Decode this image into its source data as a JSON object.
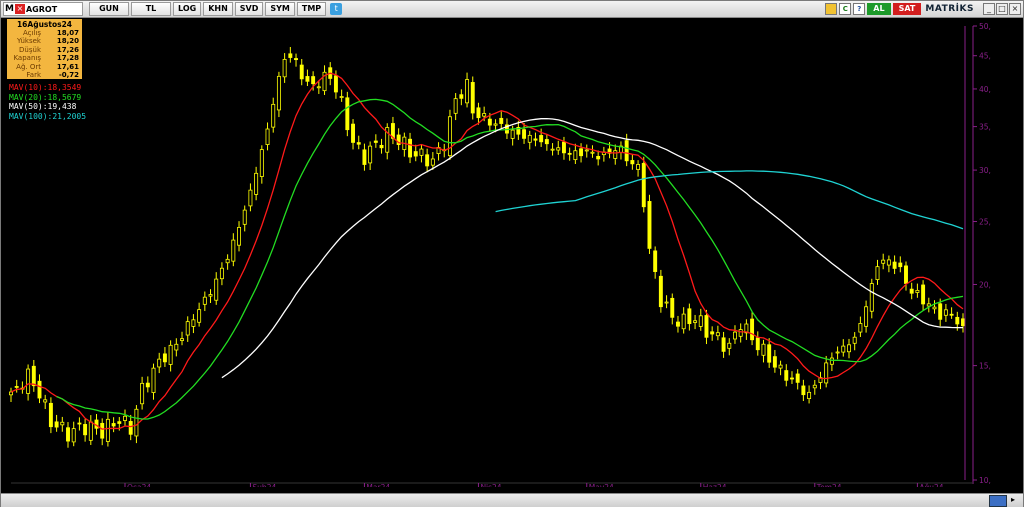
{
  "toolbar": {
    "symbol_prefix": "M",
    "symbol": "AGROT",
    "period": "GUN",
    "currency": "TL",
    "buttons": [
      "LOG",
      "KHN",
      "SVD",
      "SYM",
      "TMP"
    ],
    "twitter_icon": "twitter-icon",
    "right_icons": [
      "C",
      "?"
    ],
    "buy_label": "AL",
    "sell_label": "SAT",
    "brand": "MATRİKS",
    "buy_color": "#1d9a2a",
    "sell_color": "#d21e1e"
  },
  "info": {
    "title": "16Ağustos24",
    "rows": [
      {
        "label": "Açılış",
        "value": "18,07"
      },
      {
        "label": "Yüksek",
        "value": "18,20"
      },
      {
        "label": "Düşük",
        "value": "17,26"
      },
      {
        "label": "Kapanış",
        "value": "17,28"
      },
      {
        "label": "Ağ. Ort",
        "value": "17,61"
      },
      {
        "label": "Fark",
        "value": "-0,72"
      }
    ],
    "background": "#f3b63f"
  },
  "legend": [
    {
      "name": "MAV(10)",
      "value": ":18,3549",
      "color": "#ff1a1a"
    },
    {
      "name": "MAV(20)",
      "value": ":18,5679",
      "color": "#22dd22"
    },
    {
      "name": "MAV(50)",
      "value": ":19,438",
      "color": "#ffffff"
    },
    {
      "name": "MAV(100)",
      "value": ":21,2005",
      "color": "#1fd3d3"
    }
  ],
  "chart_data": {
    "type": "candlestick",
    "ylim": [
      10,
      50
    ],
    "log_scale": true,
    "y_ticks": [
      "50,",
      "45,",
      "40,",
      "35,",
      "30,",
      "25,",
      "20,",
      "15,",
      "10,"
    ],
    "y_tick_values": [
      50,
      45,
      40,
      35,
      30,
      25,
      20,
      15,
      10
    ],
    "x_labels": [
      "Oca24",
      "Şub24",
      "Mar24",
      "Nis24",
      "May24",
      "Haz24",
      "Tem24",
      "Ağu24"
    ],
    "x_label_index": [
      20,
      42,
      62,
      82,
      101,
      121,
      141,
      159
    ],
    "num_days": 168,
    "candle_color": "#ffff00",
    "close_anchors": [
      [
        0,
        13.5
      ],
      [
        3,
        14.5
      ],
      [
        5,
        13.6
      ],
      [
        7,
        12.3
      ],
      [
        10,
        11.8
      ],
      [
        13,
        12.1
      ],
      [
        16,
        11.9
      ],
      [
        19,
        12.4
      ],
      [
        21,
        12.0
      ],
      [
        23,
        13.8
      ],
      [
        26,
        15.2
      ],
      [
        29,
        16.2
      ],
      [
        32,
        17.8
      ],
      [
        35,
        19.5
      ],
      [
        38,
        22.0
      ],
      [
        41,
        26.0
      ],
      [
        44,
        32.0
      ],
      [
        46,
        38.0
      ],
      [
        48,
        45.0
      ],
      [
        50,
        44.0
      ],
      [
        52,
        40.5
      ],
      [
        54,
        41.0
      ],
      [
        56,
        42.0
      ],
      [
        58,
        38.0
      ],
      [
        60,
        33.0
      ],
      [
        62,
        31.5
      ],
      [
        64,
        32.8
      ],
      [
        66,
        34.0
      ],
      [
        68,
        33.5
      ],
      [
        70,
        32.0
      ],
      [
        72,
        31.5
      ],
      [
        74,
        31.0
      ],
      [
        76,
        33.0
      ],
      [
        78,
        38.5
      ],
      [
        80,
        40.5
      ],
      [
        81,
        37.0
      ],
      [
        83,
        36.0
      ],
      [
        86,
        35.0
      ],
      [
        89,
        34.0
      ],
      [
        92,
        33.5
      ],
      [
        95,
        32.5
      ],
      [
        98,
        31.8
      ],
      [
        101,
        32.0
      ],
      [
        104,
        31.5
      ],
      [
        106,
        32.5
      ],
      [
        108,
        31.5
      ],
      [
        110,
        30.0
      ],
      [
        111,
        27.0
      ],
      [
        112,
        22.5
      ],
      [
        114,
        19.0
      ],
      [
        116,
        17.8
      ],
      [
        118,
        17.5
      ],
      [
        120,
        17.8
      ],
      [
        122,
        17.0
      ],
      [
        124,
        16.5
      ],
      [
        126,
        16.0
      ],
      [
        128,
        17.5
      ],
      [
        130,
        16.5
      ],
      [
        132,
        15.8
      ],
      [
        134,
        15.0
      ],
      [
        136,
        14.5
      ],
      [
        138,
        14.0
      ],
      [
        140,
        13.5
      ],
      [
        142,
        14.5
      ],
      [
        144,
        15.5
      ],
      [
        146,
        16.0
      ],
      [
        148,
        16.5
      ],
      [
        150,
        18.5
      ],
      [
        152,
        21.5
      ],
      [
        154,
        21.8
      ],
      [
        156,
        21.0
      ],
      [
        158,
        19.5
      ],
      [
        160,
        19.0
      ],
      [
        162,
        18.2
      ],
      [
        164,
        18.0
      ],
      [
        166,
        17.8
      ],
      [
        167,
        17.28
      ]
    ],
    "mav_series": [
      {
        "name": "MAV(10)",
        "period": 10,
        "color": "#ff1a1a"
      },
      {
        "name": "MAV(20)",
        "period": 20,
        "color": "#22dd22"
      },
      {
        "name": "MAV(50)",
        "period": 50,
        "color": "#ffffff"
      },
      {
        "name": "MAV(100)",
        "period": 100,
        "color": "#1fd3d3"
      }
    ],
    "cursor_line_index": 167
  },
  "scroll": {
    "icon": "scroll-thumb-icon",
    "arrow": "▸"
  }
}
